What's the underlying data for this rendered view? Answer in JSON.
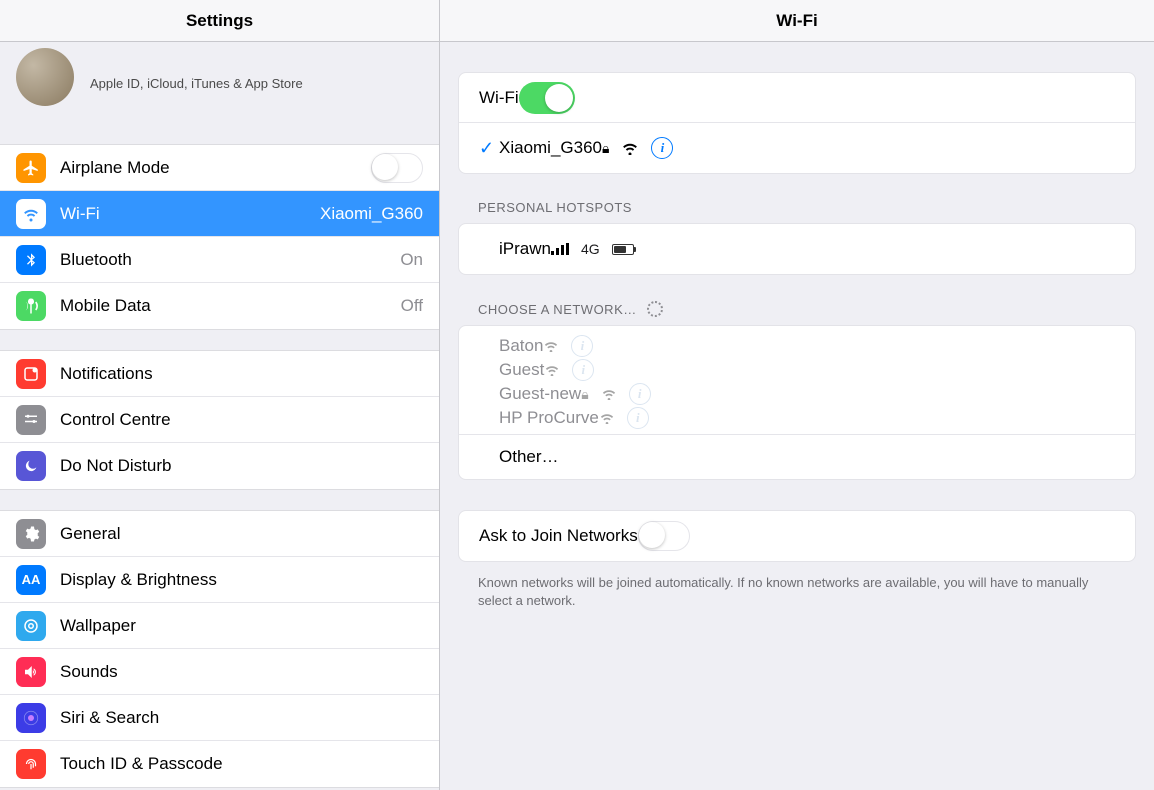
{
  "left": {
    "title": "Settings",
    "profile": {
      "subtitle": "Apple ID, iCloud, iTunes & App Store"
    },
    "group1": {
      "airplane": "Airplane Mode",
      "wifi": "Wi-Fi",
      "wifi_value": "Xiaomi_G360",
      "bluetooth": "Bluetooth",
      "bluetooth_value": "On",
      "mobile": "Mobile Data",
      "mobile_value": "Off"
    },
    "group2": {
      "notifications": "Notifications",
      "control": "Control Centre",
      "dnd": "Do Not Disturb"
    },
    "group3": {
      "general": "General",
      "display": "Display & Brightness",
      "wallpaper": "Wallpaper",
      "sounds": "Sounds",
      "siri": "Siri & Search",
      "touchid": "Touch ID & Passcode"
    }
  },
  "right": {
    "title": "Wi-Fi",
    "wifi_label": "Wi-Fi",
    "connected_network": "Xiaomi_G360",
    "personal_header": "Personal Hotspots",
    "hotspot": {
      "name": "iPrawn",
      "tech": "4G"
    },
    "choose_header": "Choose a Network…",
    "networks": [
      {
        "name": "Baton",
        "locked": false
      },
      {
        "name": "Guest",
        "locked": false
      },
      {
        "name": "Guest-new",
        "locked": true
      },
      {
        "name": "HP ProCurve",
        "locked": false
      }
    ],
    "other": "Other…",
    "ask_label": "Ask to Join Networks",
    "ask_footer": "Known networks will be joined automatically. If no known networks are available, you will have to manually select a network."
  }
}
